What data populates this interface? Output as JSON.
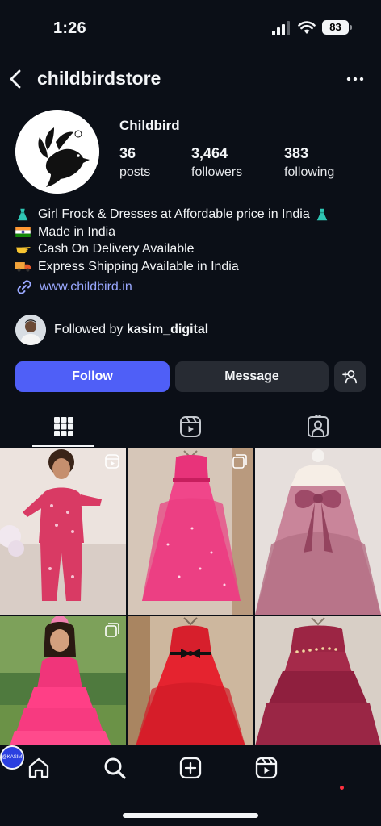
{
  "status_bar": {
    "time": "1:26",
    "battery": "83",
    "icons": [
      "cellular-signal-icon",
      "wifi-icon",
      "battery-icon"
    ]
  },
  "header": {
    "username": "childbirdstore",
    "icons": [
      "back-chevron-icon",
      "more-options-icon"
    ]
  },
  "profile": {
    "display_name": "Childbird",
    "stats": [
      {
        "value": "36",
        "label": "posts"
      },
      {
        "value": "3,464",
        "label": "followers"
      },
      {
        "value": "383",
        "label": "following"
      }
    ],
    "bio": [
      {
        "emoji": "dress",
        "text": "Girl Frock & Dresses at Affordable price in India",
        "trailing_emoji": "dress"
      },
      {
        "emoji": "india-flag",
        "text": "Made in India"
      },
      {
        "emoji": "pointing-hand",
        "text": "Cash On Delivery Available"
      },
      {
        "emoji": "delivery-truck",
        "text": "Express Shipping Available in India"
      }
    ],
    "link": "www.childbird.in",
    "followed_by_prefix": "Followed by ",
    "followed_by_user": "kasim_digital"
  },
  "actions": {
    "follow": "Follow",
    "message": "Message"
  },
  "tabs": [
    "posts-grid-icon",
    "reels-icon",
    "tagged-icon"
  ],
  "grid": [
    {
      "subject": "girl in pink pajamas",
      "type": "reel"
    },
    {
      "subject": "pink tulle dress on hanger",
      "type": "carousel"
    },
    {
      "subject": "mauve satin gown with bow",
      "type": "post"
    },
    {
      "subject": "girl in pink ruffle dress",
      "type": "carousel"
    },
    {
      "subject": "red tulle dress",
      "type": "post"
    },
    {
      "subject": "maroon satin layered dress",
      "type": "post"
    }
  ],
  "bottom_nav": {
    "items": [
      "home-icon",
      "search-icon",
      "create-icon",
      "reels-icon",
      "profile-avatar"
    ],
    "avatar_text": "@KASIM"
  },
  "colors": {
    "background": "#0b0f17",
    "follow_button": "#4f5ff7",
    "secondary_button": "#272b33",
    "link": "#9aa8ff",
    "notification_dot": "#ff3040"
  }
}
